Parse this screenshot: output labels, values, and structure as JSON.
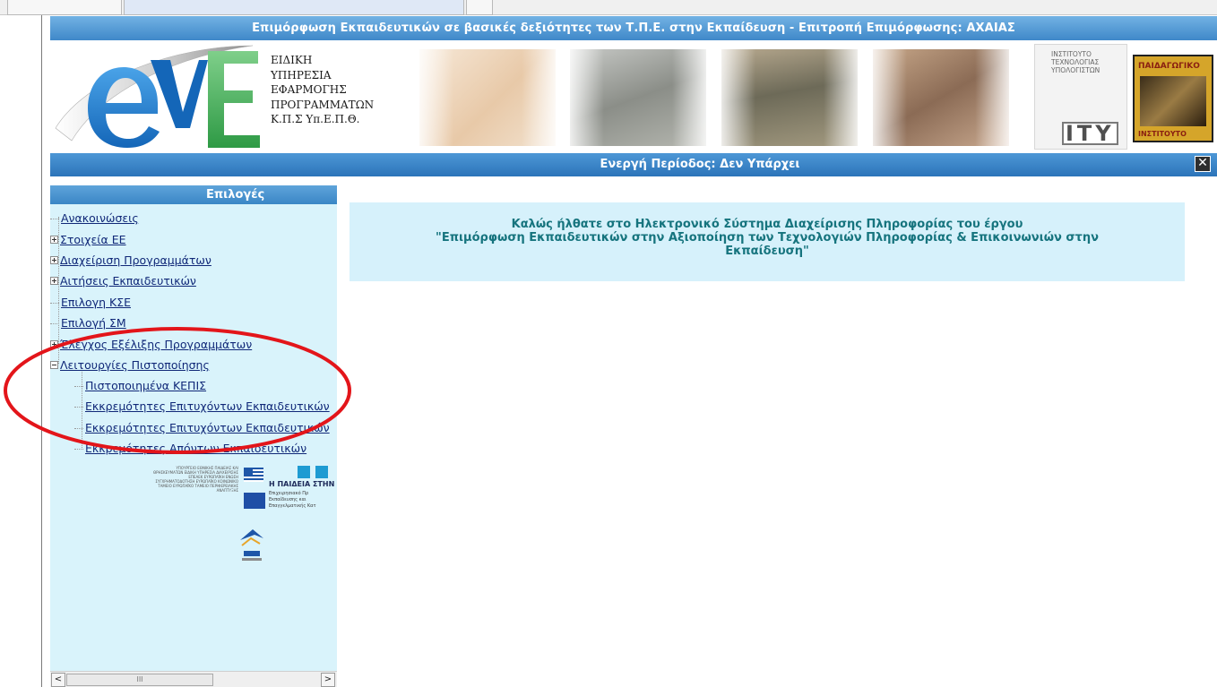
{
  "page": {
    "title": "Επιμόρφωση Εκπαιδευτικών σε βασικές δεξιότητες των Τ.Π.Ε. στην Εκπαίδευση - Επιτροπή Επιμόρφωσης: ΑΧΑΙΑΣ"
  },
  "banner": {
    "logo_text_lines": [
      "ΕΙΔΙΚΗ",
      "ΥΠΗΡΕΣΙΑ",
      "ΕΦΑΡΜΟΓΗΣ",
      "ΠΡΟΓΡΑΜΜΑΤΩΝ",
      "Κ.Π.Σ Υπ.Ε.Π.Θ."
    ],
    "ity_text": [
      "ΙΝΣΤΙΤΟΥΤΟ",
      "ΤΕΧΝΟΛΟΓΙΑΣ",
      "ΥΠΟΛΟΓΙΣΤΩΝ"
    ],
    "ity_big": "ITY",
    "paid_top": "ΠΑΙΔΑΓΩΓΙΚΟ",
    "paid_bottom": "ΙΝΣΤΙΤΟΥΤΟ"
  },
  "period": {
    "text": "Ενεργή Περίοδος: Δεν Υπάρχει",
    "close_glyph": "✕"
  },
  "sidebar": {
    "header": "Επιλογές",
    "items": [
      {
        "label": "Ανακοινώσεις",
        "type": "leaf"
      },
      {
        "label": "Στοιχεία ΕΕ",
        "type": "plus"
      },
      {
        "label": "Διαχείριση Προγραμμάτων",
        "type": "plus"
      },
      {
        "label": "Αιτήσεις Εκπαιδευτικών",
        "type": "plus"
      },
      {
        "label": "Επιλογη ΚΣΕ",
        "type": "leaf"
      },
      {
        "label": "Επιλογή ΣΜ",
        "type": "leaf"
      },
      {
        "label": "Έλεγχος Εξέλιξης Προγραμμάτων",
        "type": "plus"
      },
      {
        "label": "Λειτουργίες Πιστοποίησης",
        "type": "minus"
      }
    ],
    "subitems": [
      {
        "label": "Πιστοποιημένα ΚΕΠΙΣ"
      },
      {
        "label": "Εκκρεμότητες Επιτυχόντων Εκπαιδευτικών"
      },
      {
        "label": "Εκκρεμότητες Επιτυχόντων Εκπαιδευτικών"
      },
      {
        "label": "Εκκρεμότητες Απόντων Εκπαιδευτικών"
      }
    ],
    "eu_logo": {
      "ministry": "ΥΠΟΥΡΓΕΙΟ ΕΘΝΙΚΗΣ ΠΑΙΔΕΙΑΣ ΚΑΙ ΘΡΗΣΚΕΥΜΑΤΩΝ ΕΙΔΙΚΗ ΥΠΗΡΕΣΙΑ ΔΙΑΧΕΙΡΙΣΗΣ ΕΠΕΑΕΚ ΕΥΡΩΠΑΪΚΗ ΕΝΩΣΗ ΣΥΓΧΡΗΜΑΤΟΔΟΤΗΣΗ ΕΥΡΩΠΑΪΚΟ ΚΟΙΝΩΝΙΚΟ ΤΑΜΕΙΟ ΕΥΡΩΠΑΪΚΟ ΤΑΜΕΙΟ ΠΕΡΙΦΕΡΕΙΑΚΗΣ ΑΝΑΠΤΥΞΗΣ",
      "paideia": "Η ΠΑΙΔΕΙΑ ΣΤΗΝ",
      "paideia_sub": [
        "Επιχειρησιακό Πρ",
        "Εκπαίδευσης και",
        "Επαγγελματικής Κατ"
      ]
    },
    "scroll": {
      "left": "<",
      "right": ">",
      "thumb": "III"
    }
  },
  "main": {
    "welcome_lines": [
      "Καλώς ήλθατε στο Ηλεκτρονικό Σύστημα Διαχείρισης Πληροφορίας του έργου",
      "\"Επιμόρφωση Εκπαιδευτικών στην Αξιοποίηση των Τεχνολογιών Πληροφορίας & Επικοινωνιών στην",
      "Εκπαίδευση\""
    ]
  },
  "colors": {
    "title_bar": "#4a94d2",
    "sidebar_bg": "#d9f3fb",
    "welcome_bg": "#d6f1fb",
    "welcome_text": "#16747e",
    "link": "#102878",
    "annotation": "#e3151a"
  }
}
